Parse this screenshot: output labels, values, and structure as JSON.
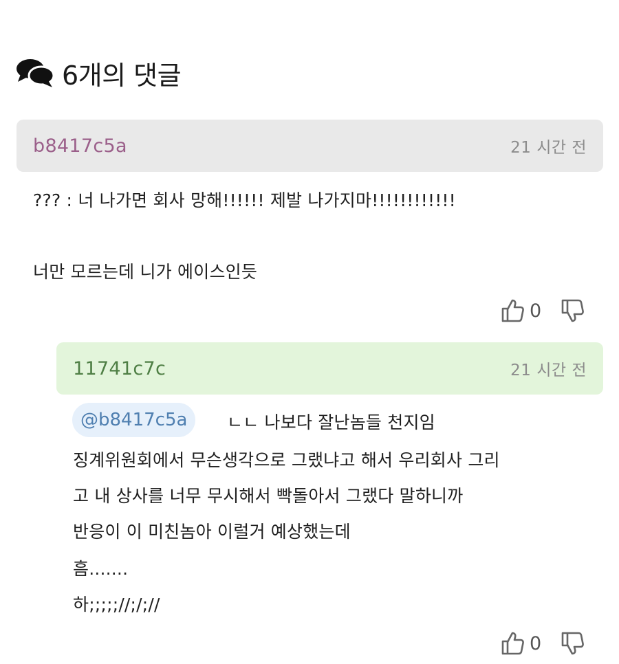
{
  "header": {
    "title": "6개의 댓글",
    "icon": "comments-icon"
  },
  "comments": [
    {
      "author": "b8417c5a",
      "time": "21 시간 전",
      "lines": [
        "??? : 너 나가면 회사 망해!!!!!! 제발 나가지마!!!!!!!!!!!!",
        "너만 모르는데 니가 에이스인듯"
      ],
      "likes": "0",
      "author_color": "#9b5f8a",
      "head_bg": "#e9e9e9"
    },
    {
      "author": "11741c7c",
      "time": "21 시간 전",
      "mention": "@b8417c5a",
      "lines": [
        "ㄴㄴ 나보다 잘난놈들 천지임",
        "징계위원회에서 무슨생각으로 그랬냐고 해서 우리회사 그리",
        "고 내 상사를 너무 무시해서 빡돌아서 그랬다 말하니까",
        "반응이 이 미친놈아 이럴거 예상했는데",
        "흠.......",
        "하;;;;;//;/;//"
      ],
      "likes": "0",
      "author_color": "#4f7f45",
      "head_bg": "#e3f5db"
    }
  ]
}
